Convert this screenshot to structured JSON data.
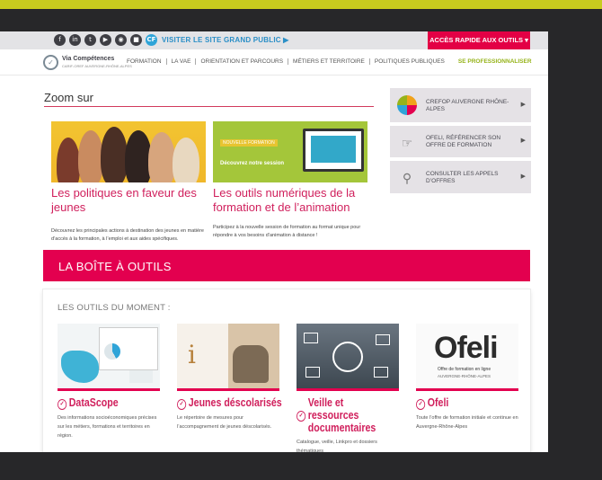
{
  "topbar": {
    "social_icons": [
      "facebook-icon",
      "linkedin-icon",
      "twitter-icon",
      "youtube-icon",
      "rss-icon",
      "video-icon",
      "cf-icon"
    ],
    "cf_label": "CF",
    "visit_label": "VISITER LE SITE GRAND PUBLIC ▶",
    "quick_access_label": "ACCÈS RAPIDE AUX OUTILS ▾"
  },
  "logo": {
    "name": "Via Compétences",
    "sub": "CARIF-OREF AUVERGNE-RHÔNE-ALPES"
  },
  "nav": {
    "items": [
      "FORMATION",
      "LA VAE",
      "ORIENTATION ET PARCOURS",
      "MÉTIERS ET TERRITOIRE",
      "POLITIQUES PUBLIQUES"
    ],
    "pro": "SE PROFESSIONNALISER"
  },
  "zoom": {
    "title": "Zoom sur",
    "cards": [
      {
        "heading": "Les politiques en faveur des jeunes",
        "desc": "Découvrez les principales actions à destination des jeunes en matière d’accès à la formation, à l’emploi et aux aides spécifiques."
      },
      {
        "heading": "Les outils numériques de la formation et de l’animation",
        "desc": "Participez à la nouvelle session de formation au format unique pour répondre à vos besoins d’animation à distance !",
        "tag": "NOUVELLE FORMATION",
        "tag2": "Découvrez notre session"
      }
    ]
  },
  "right_panel": [
    {
      "label": "CREFOP AUVERGNE RHÔNE-ALPES",
      "icon": "crefop-logo-icon"
    },
    {
      "label": "OFELI, RÉFÉRENCER SON OFFRE DE FORMATION",
      "icon": "pointing-hand-icon"
    },
    {
      "label": "CONSULTER LES APPELS D’OFFRES",
      "icon": "people-search-icon"
    }
  ],
  "toolbox": {
    "banner": "LA BOÎTE À OUTILS",
    "subtitle": "LES OUTILS DU MOMENT :",
    "tiles": [
      {
        "title": "DataScope",
        "desc": "Des informations socioéconomiques précises sur les métiers, formations et territoires en région."
      },
      {
        "title": "Jeunes déscolarisés",
        "desc": "Le répertoire de mesures pour l’accompagnement de jeunes déscolarisés."
      },
      {
        "title": "Veille et ressources documentaires",
        "desc": "Catalogue, veille, Linkpro et dossiers thématiques"
      },
      {
        "title": "Ofeli",
        "desc": "Toute l’offre de formation initiale et continue en Auvergne-Rhône-Alpes",
        "img_big": "Ofeli",
        "img_small": "Offre de formation en ligne",
        "img_small2": "AUVERGNE-RHÔNE-ALPES"
      }
    ],
    "info_glyph": "i"
  },
  "colors": {
    "accent": "#e3004f",
    "green": "#96b31a",
    "link": "#2b8fc7",
    "frame": "#272729",
    "band": "#c8cc1e"
  }
}
